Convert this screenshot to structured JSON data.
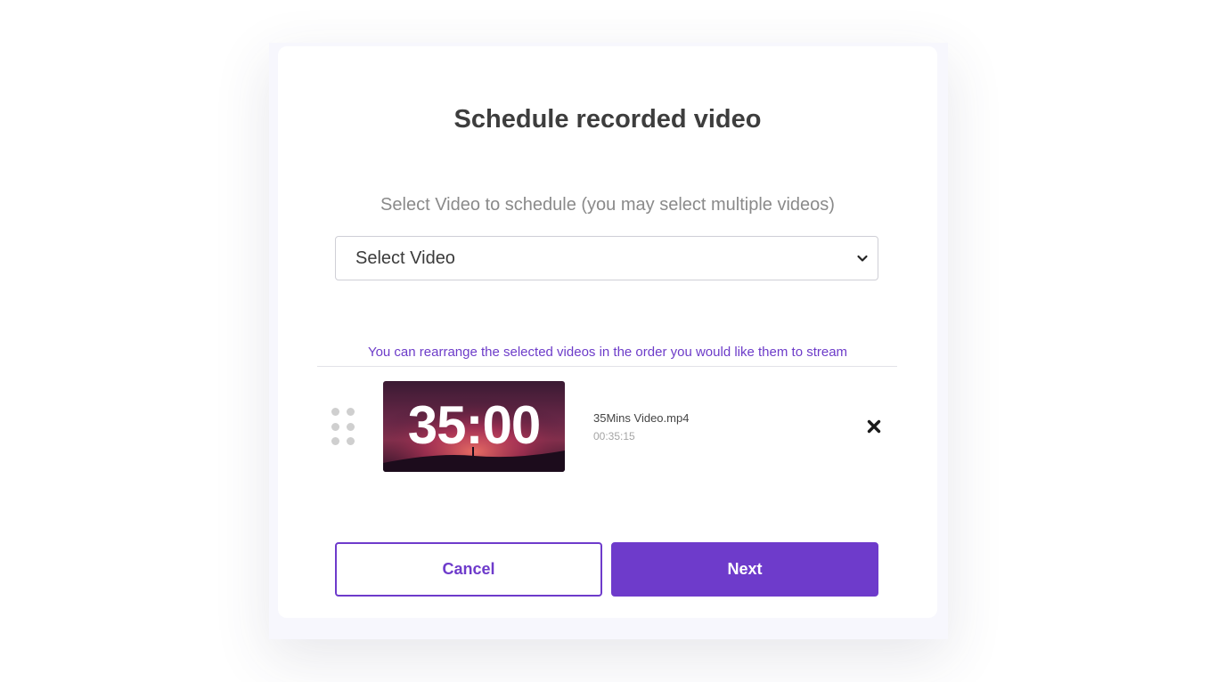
{
  "modal": {
    "title": "Schedule recorded video",
    "select_label": "Select Video to schedule (you may select multiple videos)",
    "select": {
      "selected_value": "Select Video"
    },
    "hint": "You can rearrange the selected videos in the order you would like them to stream",
    "videos": [
      {
        "thumbnail_text": "35:00",
        "file_name": "35Mins Video.mp4",
        "duration": "00:35:15"
      }
    ],
    "buttons": {
      "cancel_label": "Cancel",
      "next_label": "Next"
    }
  },
  "colors": {
    "accent": "#6e3bcb",
    "title": "#3d3d3d",
    "muted": "#8a8a8a"
  },
  "icons": {
    "drag": "drag-handle-icon",
    "remove": "close-icon",
    "dropdown": "chevron-down-icon"
  }
}
